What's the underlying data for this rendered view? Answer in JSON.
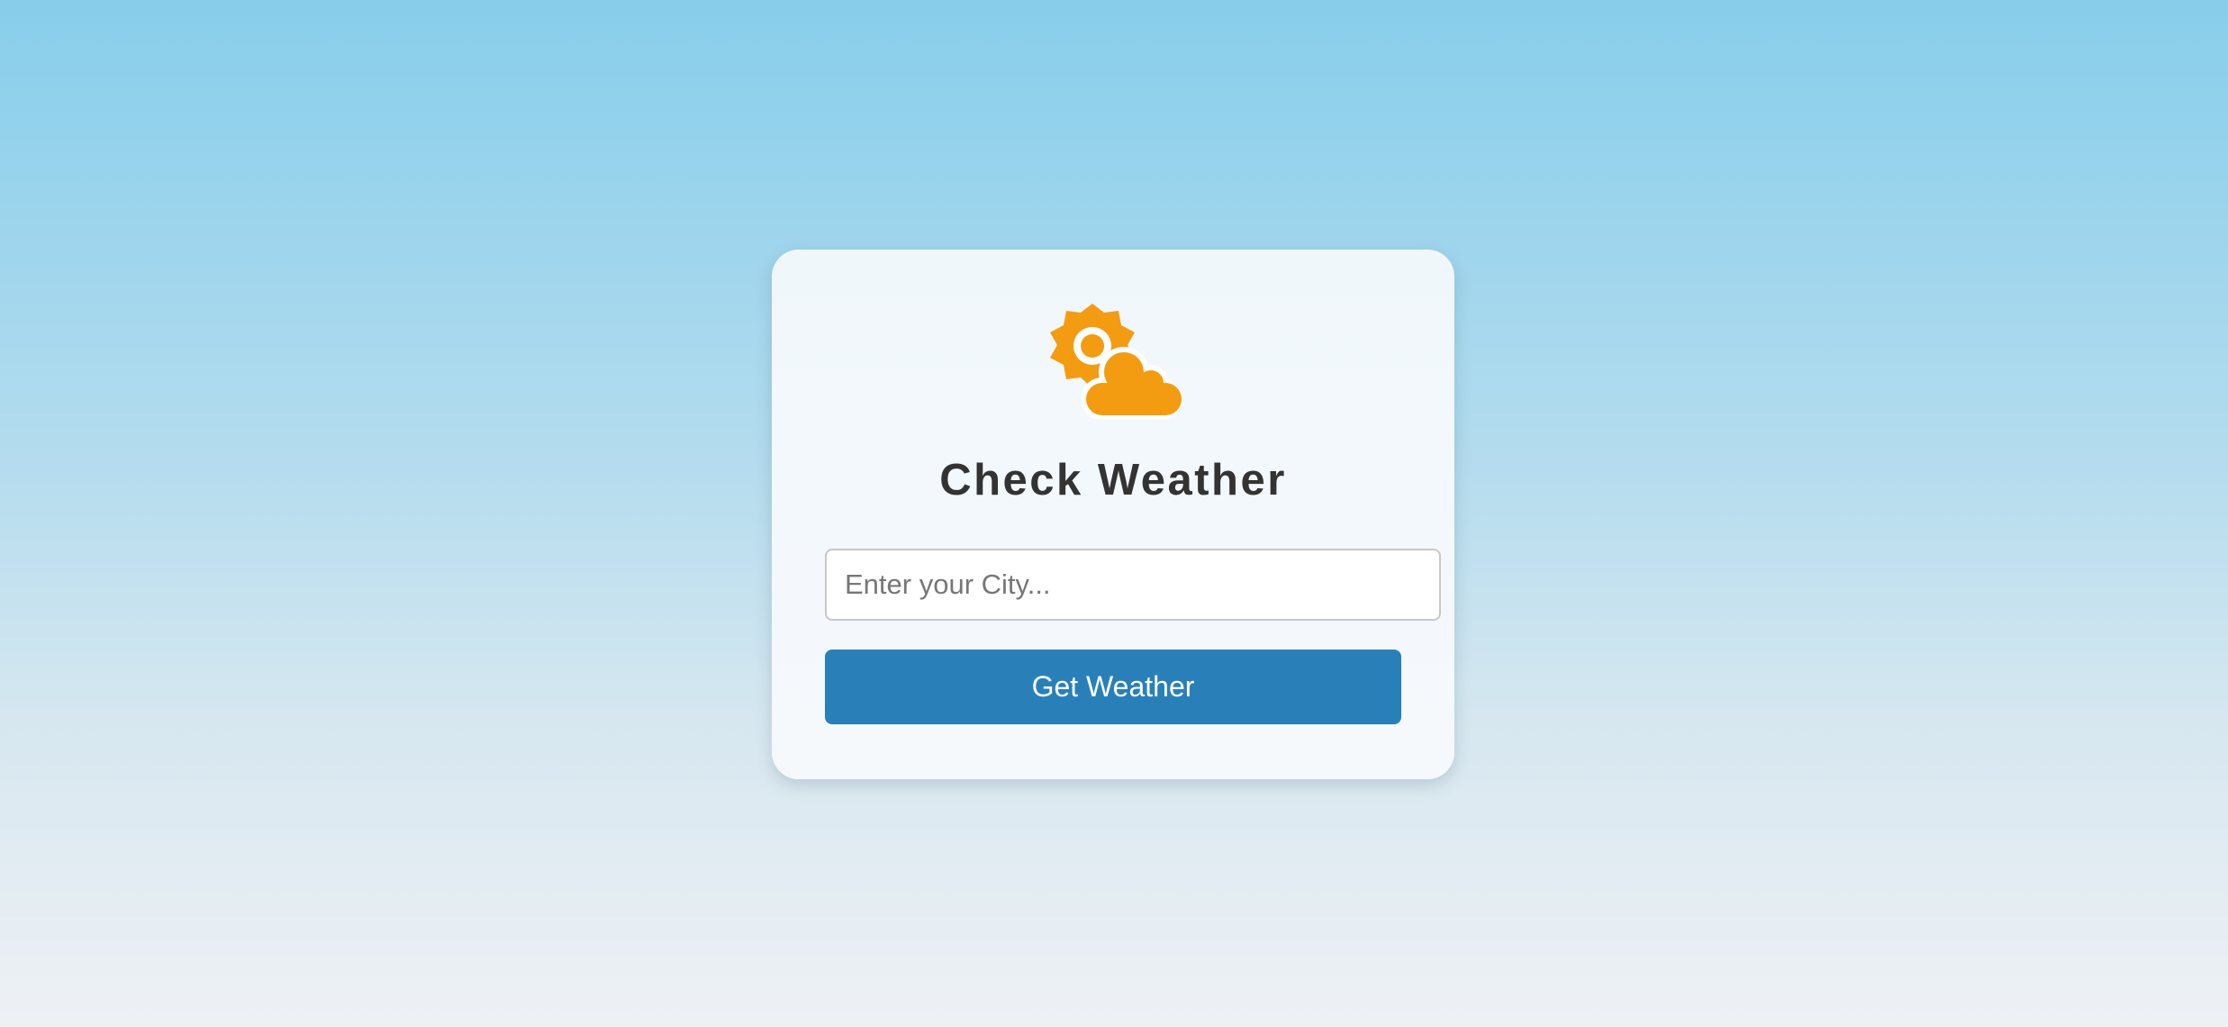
{
  "card": {
    "icon": "sun-behind-cloud-icon",
    "title": "Check Weather",
    "city_input": {
      "value": "",
      "placeholder": "Enter your City..."
    },
    "button_label": "Get Weather"
  },
  "colors": {
    "background_top": "#87ceeb",
    "background_bottom": "#eef1f4",
    "icon": "#f39c12",
    "title": "#333333",
    "button": "#2980b9",
    "button_text": "#ffffff"
  }
}
